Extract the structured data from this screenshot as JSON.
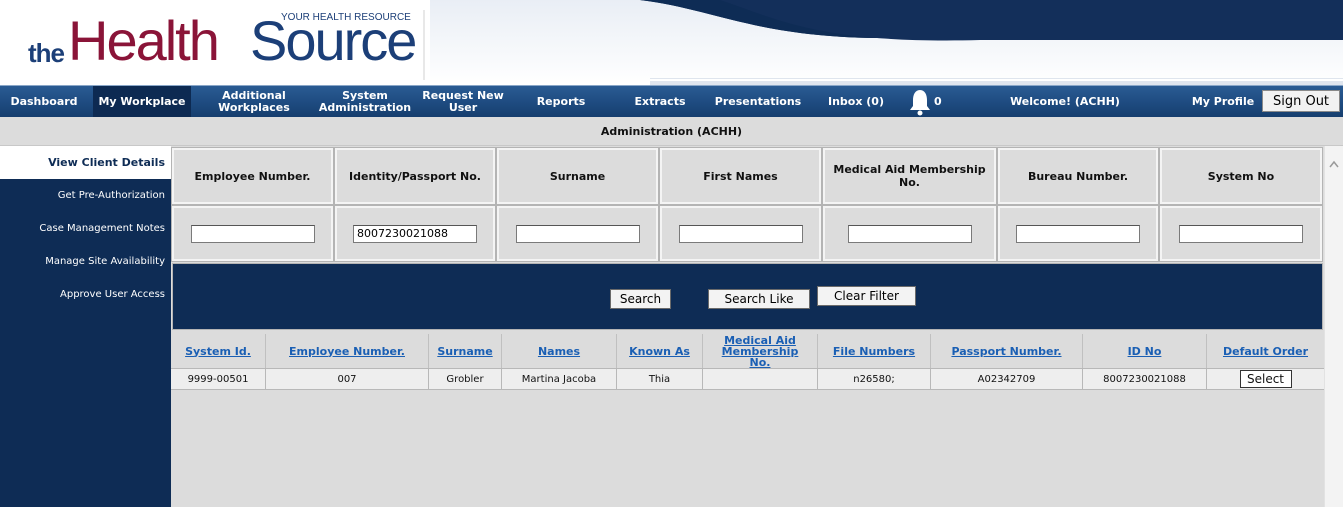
{
  "logo": {
    "the": "the",
    "health": "Health",
    "source": "Source",
    "tagline": "YOUR HEALTH RESOURCE"
  },
  "nav": {
    "items": [
      {
        "label": "Dashboard"
      },
      {
        "label": "My Workplace"
      },
      {
        "label": "Additional Workplaces"
      },
      {
        "label": "System Administration"
      },
      {
        "label": "Request New User"
      },
      {
        "label": "Reports"
      },
      {
        "label": "Extracts"
      },
      {
        "label": "Presentations"
      },
      {
        "label": "Inbox (0)"
      }
    ],
    "notification_count": "0",
    "welcome": "Welcome! (ACHH)",
    "my_profile": "My Profile",
    "sign_out": "Sign Out"
  },
  "page_title": "Administration (ACHH)",
  "sidebar": {
    "items": [
      {
        "label": "View Client Details"
      },
      {
        "label": "Get Pre-Authorization"
      },
      {
        "label": "Case Management Notes"
      },
      {
        "label": "Manage Site Availability"
      },
      {
        "label": "Approve User Access"
      }
    ]
  },
  "search": {
    "headers": [
      "Employee Number.",
      "Identity/Passport No.",
      "Surname",
      "First Names",
      "Medical Aid Membership No.",
      "Bureau Number.",
      "System No"
    ],
    "values": [
      "",
      "8007230021088",
      "",
      "",
      "",
      "",
      ""
    ],
    "buttons": {
      "search": "Search",
      "search_like": "Search Like",
      "clear_filter": "Clear Filter"
    }
  },
  "results": {
    "headers": [
      "System Id.",
      "Employee Number.",
      "Surname",
      "Names",
      "Known As",
      "Medical Aid Membership No.",
      "File Numbers",
      "Passport Number.",
      "ID No",
      "Default Order"
    ],
    "rows": [
      [
        "9999-00501",
        "007",
        "Grobler",
        "Martina Jacoba",
        "Thia",
        "",
        "n26580;",
        "A02342709",
        "8007230021088",
        "Select"
      ]
    ]
  },
  "colors": {
    "nav_blue": "#1e4b80",
    "sidebar_navy": "#0e2c55",
    "brand_maroon": "#8a1438",
    "link_blue": "#1a5fb4"
  }
}
